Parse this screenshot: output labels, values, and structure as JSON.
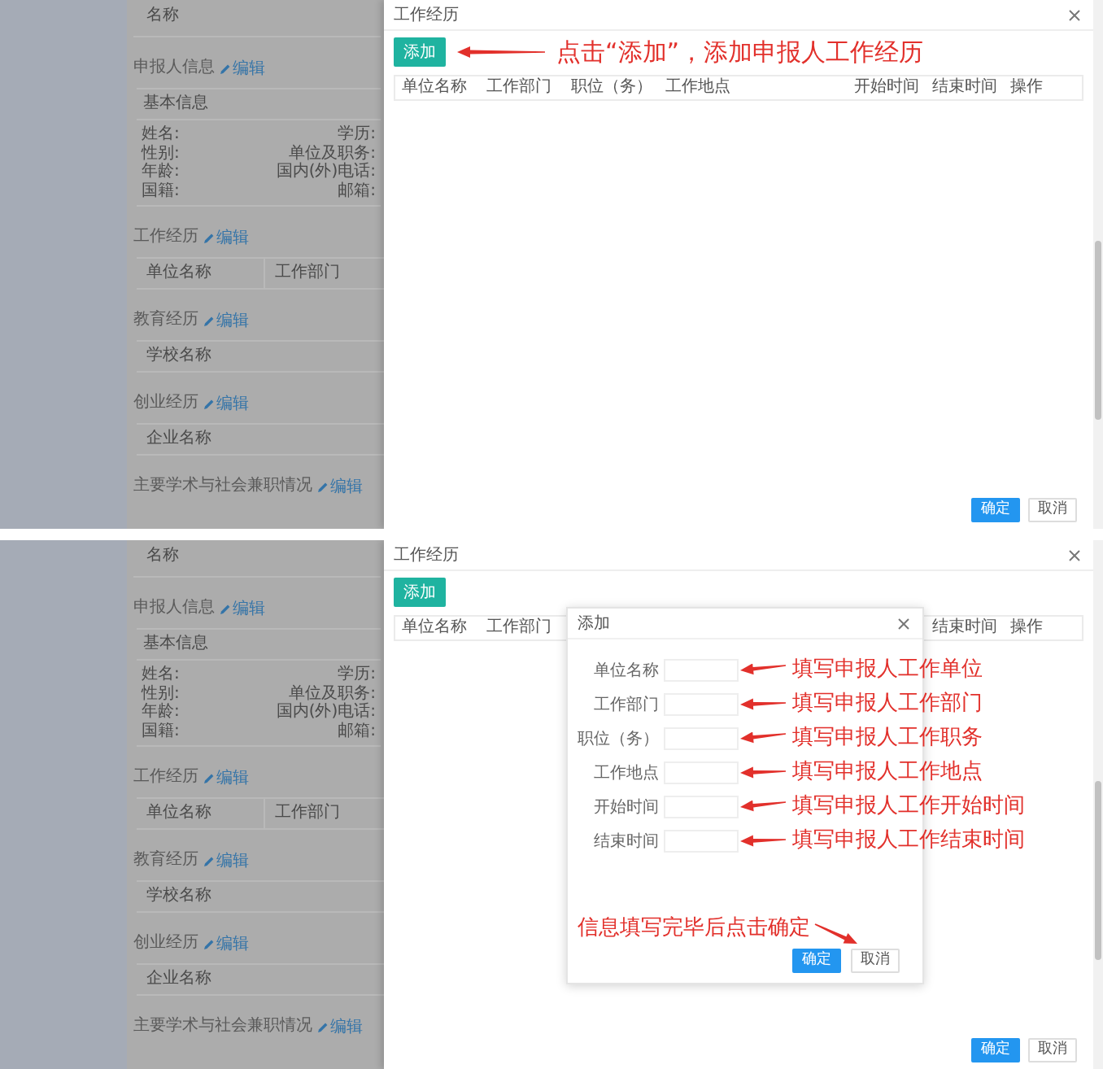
{
  "panels": [
    {
      "page": {
        "top_row": "名称",
        "sections": [
          {
            "title": "申报人信息",
            "edit": "编辑",
            "kind": "info",
            "card_title": "基本信息",
            "fields": [
              {
                "left": "姓名:",
                "right": "学历:"
              },
              {
                "left": "性别:",
                "right": "单位及职务:"
              },
              {
                "left": "年龄:",
                "right": "国内(外)电话:"
              },
              {
                "left": "国籍:",
                "right": "邮箱:"
              }
            ]
          },
          {
            "title": "工作经历",
            "edit": "编辑",
            "kind": "table",
            "columns": [
              "单位名称",
              "工作部门"
            ]
          },
          {
            "title": "教育经历",
            "edit": "编辑",
            "kind": "table",
            "columns": [
              "学校名称"
            ]
          },
          {
            "title": "创业经历",
            "edit": "编辑",
            "kind": "table",
            "columns": [
              "企业名称"
            ]
          },
          {
            "title": "主要学术与社会兼职情况",
            "edit": "编辑",
            "kind": "heading"
          }
        ]
      },
      "dialog": {
        "title": "工作经历",
        "add_button": "添加",
        "add_annotation": "点击“添加”，添加申报人工作经历",
        "table": {
          "columns_left": [
            "单位名称",
            "工作部门",
            "职位（务）",
            "工作地点"
          ],
          "columns_right": [
            "开始时间",
            "结束时间",
            "操作"
          ]
        },
        "buttons": [
          {
            "label": "确定",
            "kind": "primary"
          },
          {
            "label": "取消",
            "kind": "default"
          }
        ]
      }
    },
    {
      "page": {
        "top_row": "名称",
        "sections": [
          {
            "title": "申报人信息",
            "edit": "编辑",
            "kind": "info",
            "card_title": "基本信息",
            "fields": [
              {
                "left": "姓名:",
                "right": "学历:"
              },
              {
                "left": "性别:",
                "right": "单位及职务:"
              },
              {
                "left": "年龄:",
                "right": "国内(外)电话:"
              },
              {
                "left": "国籍:",
                "right": "邮箱:"
              }
            ]
          },
          {
            "title": "工作经历",
            "edit": "编辑",
            "kind": "table",
            "columns": [
              "单位名称",
              "工作部门"
            ]
          },
          {
            "title": "教育经历",
            "edit": "编辑",
            "kind": "table",
            "columns": [
              "学校名称"
            ]
          },
          {
            "title": "创业经历",
            "edit": "编辑",
            "kind": "table",
            "columns": [
              "企业名称"
            ]
          },
          {
            "title": "主要学术与社会兼职情况",
            "edit": "编辑",
            "kind": "heading"
          }
        ]
      },
      "dialog": {
        "title": "工作经历",
        "add_button": "添加",
        "table": {
          "columns_left": [
            "单位名称",
            "工作部门"
          ],
          "columns_right": [
            "结束时间",
            "操作"
          ]
        },
        "buttons": [
          {
            "label": "确定",
            "kind": "primary"
          },
          {
            "label": "取消",
            "kind": "default"
          }
        ],
        "form_dialog": {
          "title": "添加",
          "fields": [
            {
              "label": "单位名称",
              "annotation": "填写申报人工作单位"
            },
            {
              "label": "工作部门",
              "annotation": "填写申报人工作部门"
            },
            {
              "label": "职位（务）",
              "annotation": "填写申报人工作职务"
            },
            {
              "label": "工作地点",
              "annotation": "填写申报人工作地点"
            },
            {
              "label": "开始时间",
              "annotation": "填写申报人工作开始时间"
            },
            {
              "label": "结束时间",
              "annotation": "填写申报人工作结束时间"
            }
          ],
          "footer_annotation": "信息填写完毕后点击确定",
          "buttons": [
            {
              "label": "确定",
              "kind": "primary"
            },
            {
              "label": "取消",
              "kind": "default"
            }
          ]
        }
      }
    }
  ]
}
